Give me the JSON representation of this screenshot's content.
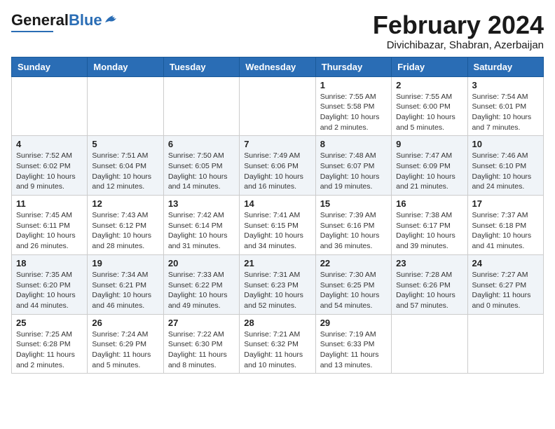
{
  "header": {
    "logo_general": "General",
    "logo_blue": "Blue",
    "month_title": "February 2024",
    "location": "Divichibazar, Shabran, Azerbaijan"
  },
  "days_of_week": [
    "Sunday",
    "Monday",
    "Tuesday",
    "Wednesday",
    "Thursday",
    "Friday",
    "Saturday"
  ],
  "weeks": [
    [
      {
        "day": "",
        "info": ""
      },
      {
        "day": "",
        "info": ""
      },
      {
        "day": "",
        "info": ""
      },
      {
        "day": "",
        "info": ""
      },
      {
        "day": "1",
        "info": "Sunrise: 7:55 AM\nSunset: 5:58 PM\nDaylight: 10 hours\nand 2 minutes."
      },
      {
        "day": "2",
        "info": "Sunrise: 7:55 AM\nSunset: 6:00 PM\nDaylight: 10 hours\nand 5 minutes."
      },
      {
        "day": "3",
        "info": "Sunrise: 7:54 AM\nSunset: 6:01 PM\nDaylight: 10 hours\nand 7 minutes."
      }
    ],
    [
      {
        "day": "4",
        "info": "Sunrise: 7:52 AM\nSunset: 6:02 PM\nDaylight: 10 hours\nand 9 minutes."
      },
      {
        "day": "5",
        "info": "Sunrise: 7:51 AM\nSunset: 6:04 PM\nDaylight: 10 hours\nand 12 minutes."
      },
      {
        "day": "6",
        "info": "Sunrise: 7:50 AM\nSunset: 6:05 PM\nDaylight: 10 hours\nand 14 minutes."
      },
      {
        "day": "7",
        "info": "Sunrise: 7:49 AM\nSunset: 6:06 PM\nDaylight: 10 hours\nand 16 minutes."
      },
      {
        "day": "8",
        "info": "Sunrise: 7:48 AM\nSunset: 6:07 PM\nDaylight: 10 hours\nand 19 minutes."
      },
      {
        "day": "9",
        "info": "Sunrise: 7:47 AM\nSunset: 6:09 PM\nDaylight: 10 hours\nand 21 minutes."
      },
      {
        "day": "10",
        "info": "Sunrise: 7:46 AM\nSunset: 6:10 PM\nDaylight: 10 hours\nand 24 minutes."
      }
    ],
    [
      {
        "day": "11",
        "info": "Sunrise: 7:45 AM\nSunset: 6:11 PM\nDaylight: 10 hours\nand 26 minutes."
      },
      {
        "day": "12",
        "info": "Sunrise: 7:43 AM\nSunset: 6:12 PM\nDaylight: 10 hours\nand 28 minutes."
      },
      {
        "day": "13",
        "info": "Sunrise: 7:42 AM\nSunset: 6:14 PM\nDaylight: 10 hours\nand 31 minutes."
      },
      {
        "day": "14",
        "info": "Sunrise: 7:41 AM\nSunset: 6:15 PM\nDaylight: 10 hours\nand 34 minutes."
      },
      {
        "day": "15",
        "info": "Sunrise: 7:39 AM\nSunset: 6:16 PM\nDaylight: 10 hours\nand 36 minutes."
      },
      {
        "day": "16",
        "info": "Sunrise: 7:38 AM\nSunset: 6:17 PM\nDaylight: 10 hours\nand 39 minutes."
      },
      {
        "day": "17",
        "info": "Sunrise: 7:37 AM\nSunset: 6:18 PM\nDaylight: 10 hours\nand 41 minutes."
      }
    ],
    [
      {
        "day": "18",
        "info": "Sunrise: 7:35 AM\nSunset: 6:20 PM\nDaylight: 10 hours\nand 44 minutes."
      },
      {
        "day": "19",
        "info": "Sunrise: 7:34 AM\nSunset: 6:21 PM\nDaylight: 10 hours\nand 46 minutes."
      },
      {
        "day": "20",
        "info": "Sunrise: 7:33 AM\nSunset: 6:22 PM\nDaylight: 10 hours\nand 49 minutes."
      },
      {
        "day": "21",
        "info": "Sunrise: 7:31 AM\nSunset: 6:23 PM\nDaylight: 10 hours\nand 52 minutes."
      },
      {
        "day": "22",
        "info": "Sunrise: 7:30 AM\nSunset: 6:25 PM\nDaylight: 10 hours\nand 54 minutes."
      },
      {
        "day": "23",
        "info": "Sunrise: 7:28 AM\nSunset: 6:26 PM\nDaylight: 10 hours\nand 57 minutes."
      },
      {
        "day": "24",
        "info": "Sunrise: 7:27 AM\nSunset: 6:27 PM\nDaylight: 11 hours\nand 0 minutes."
      }
    ],
    [
      {
        "day": "25",
        "info": "Sunrise: 7:25 AM\nSunset: 6:28 PM\nDaylight: 11 hours\nand 2 minutes."
      },
      {
        "day": "26",
        "info": "Sunrise: 7:24 AM\nSunset: 6:29 PM\nDaylight: 11 hours\nand 5 minutes."
      },
      {
        "day": "27",
        "info": "Sunrise: 7:22 AM\nSunset: 6:30 PM\nDaylight: 11 hours\nand 8 minutes."
      },
      {
        "day": "28",
        "info": "Sunrise: 7:21 AM\nSunset: 6:32 PM\nDaylight: 11 hours\nand 10 minutes."
      },
      {
        "day": "29",
        "info": "Sunrise: 7:19 AM\nSunset: 6:33 PM\nDaylight: 11 hours\nand 13 minutes."
      },
      {
        "day": "",
        "info": ""
      },
      {
        "day": "",
        "info": ""
      }
    ]
  ]
}
